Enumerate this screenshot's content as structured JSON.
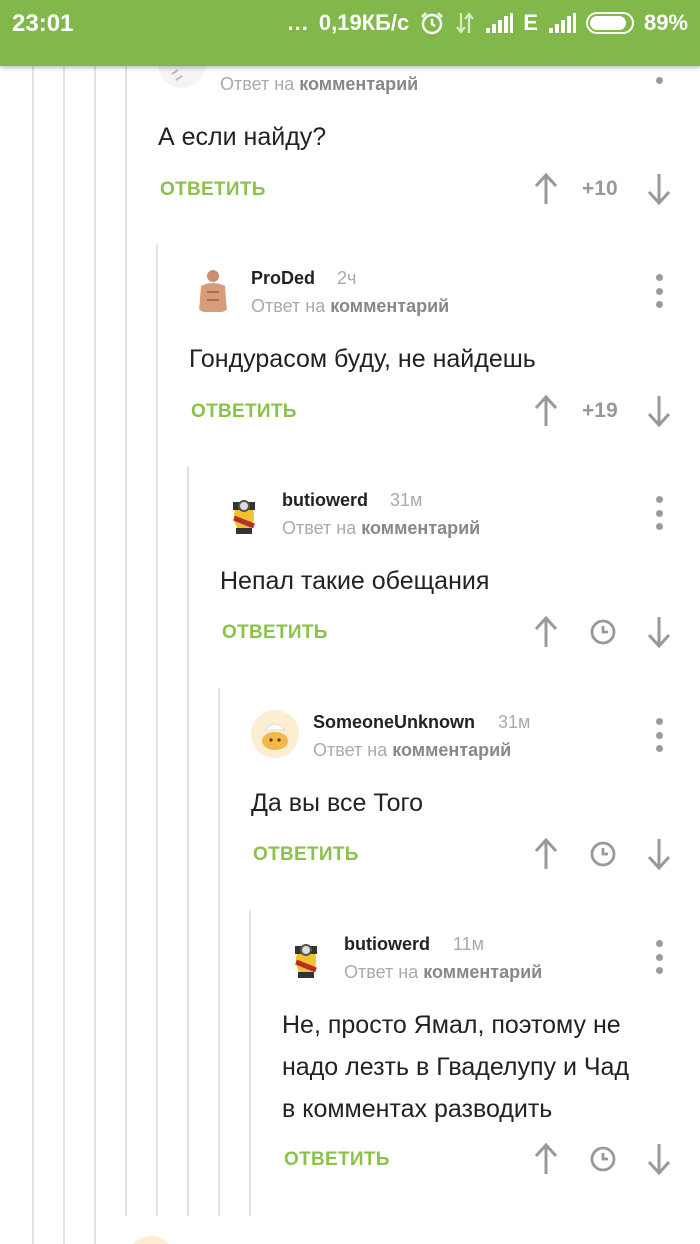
{
  "status_bar": {
    "time": "23:01",
    "dots": "...",
    "speed": "0,19КБ/с",
    "network_label": "E",
    "battery": "89%",
    "battery_level": 0.89
  },
  "comments": [
    {
      "reply_prefix": "Ответ на",
      "reply_target": "комментарий",
      "text": "А если найду?",
      "reply_label": "ОТВЕТИТЬ",
      "score": "+10"
    },
    {
      "author": "ProDed",
      "time": "2ч",
      "reply_prefix": "Ответ на",
      "reply_target": "комментарий",
      "text": "Гондурасом буду, не найдешь",
      "reply_label": "ОТВЕТИТЬ",
      "score": "+19"
    },
    {
      "author": "butiowerd",
      "time": "31м",
      "reply_prefix": "Ответ на",
      "reply_target": "комментарий",
      "text": "Непал такие обещания",
      "reply_label": "ОТВЕТИТЬ"
    },
    {
      "author": "SomeoneUnknown",
      "time": "31м",
      "reply_prefix": "Ответ на",
      "reply_target": "комментарий",
      "text": "Да вы все Того",
      "reply_label": "ОТВЕТИТЬ"
    },
    {
      "author": "butiowerd",
      "time": "11м",
      "reply_prefix": "Ответ на",
      "reply_target": "комментарий",
      "text_lines": [
        "Не, просто Ямал, поэтому не",
        "надо лезть в Гваделупу и Чад",
        "в комментах разводить"
      ],
      "reply_label": "ОТВЕТИТЬ"
    }
  ],
  "colors": {
    "status_bar": "#82b74b",
    "reply_button": "#8ac24a",
    "secondary_text": "#aaaaaa"
  },
  "icons": {
    "vote_up": "arrow-up-icon",
    "vote_down": "arrow-down-icon",
    "pending": "clock-icon",
    "menu": "more-vertical-icon"
  }
}
